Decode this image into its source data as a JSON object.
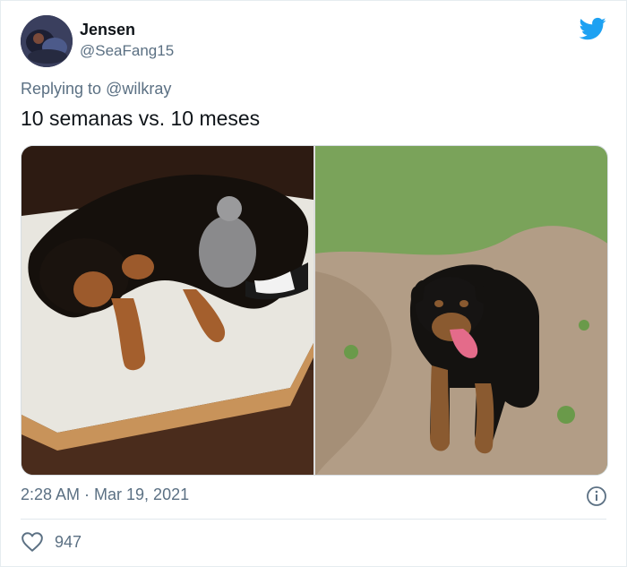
{
  "author": {
    "name": "Jensen",
    "handle": "@SeaFang15",
    "avatar_icon": "profile-avatar"
  },
  "reply": {
    "prefix": "Replying to",
    "mention": "@wilkray"
  },
  "tweet_text": "10 semanas vs. 10 meses",
  "media": {
    "left_alt": "puppy-sleeping-on-bed-photo",
    "right_alt": "grown-rottweiler-lying-on-grass-photo"
  },
  "timestamp": "2:28 AM · Mar 19, 2021",
  "likes": "947",
  "colors": {
    "brand": "#1da1f2",
    "secondary_text": "#5b7083",
    "primary_text": "#0f1419",
    "like_icon": "#5b7083"
  },
  "icons": {
    "brand": "twitter-bird-icon",
    "info": "info-icon",
    "like": "heart-icon"
  }
}
